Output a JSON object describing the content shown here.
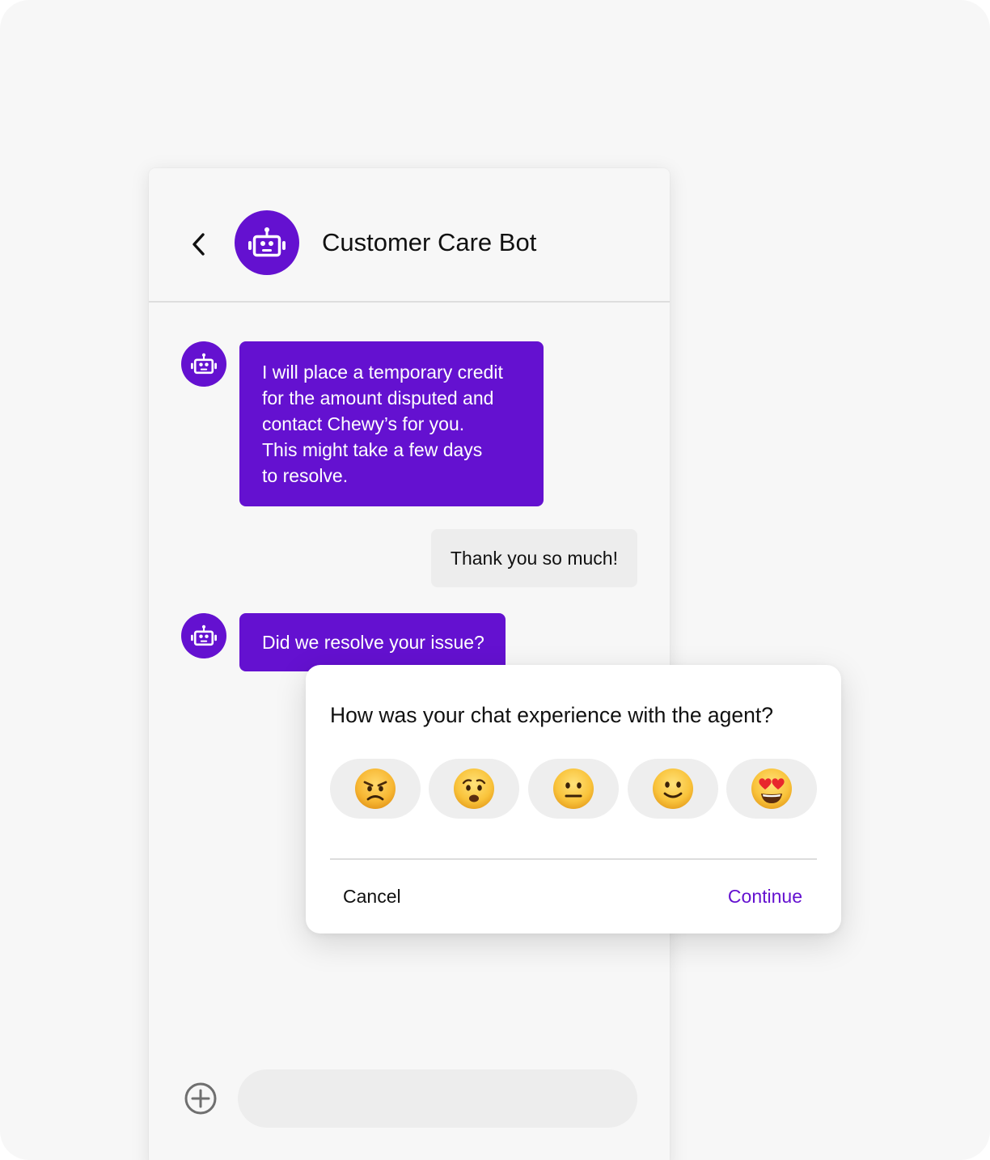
{
  "colors": {
    "brand": "#6411d0",
    "user_bubble": "#ededed",
    "background": "#f7f7f7"
  },
  "header": {
    "back_icon": "chevron-left-icon",
    "avatar_icon": "robot-icon",
    "title": "Customer Care Bot"
  },
  "messages": [
    {
      "sender": "bot",
      "lines": [
        "I will place a temporary credit",
        "for the amount disputed and",
        "contact Chewy’s for you.",
        "This might take a few days",
        "to resolve."
      ]
    },
    {
      "sender": "user",
      "text": "Thank you so much!"
    },
    {
      "sender": "bot",
      "text": "Did we resolve your issue?"
    }
  ],
  "composer": {
    "add_icon": "plus-circle-icon",
    "input_value": ""
  },
  "rating_modal": {
    "question": "How was your chat experience with the agent?",
    "options": [
      {
        "name": "angry",
        "emoji": "😠"
      },
      {
        "name": "worried",
        "emoji": "😟"
      },
      {
        "name": "neutral",
        "emoji": "😐"
      },
      {
        "name": "slightly-smiling",
        "emoji": "🙂"
      },
      {
        "name": "heart-eyes",
        "emoji": "😍"
      }
    ],
    "cancel_label": "Cancel",
    "continue_label": "Continue"
  }
}
